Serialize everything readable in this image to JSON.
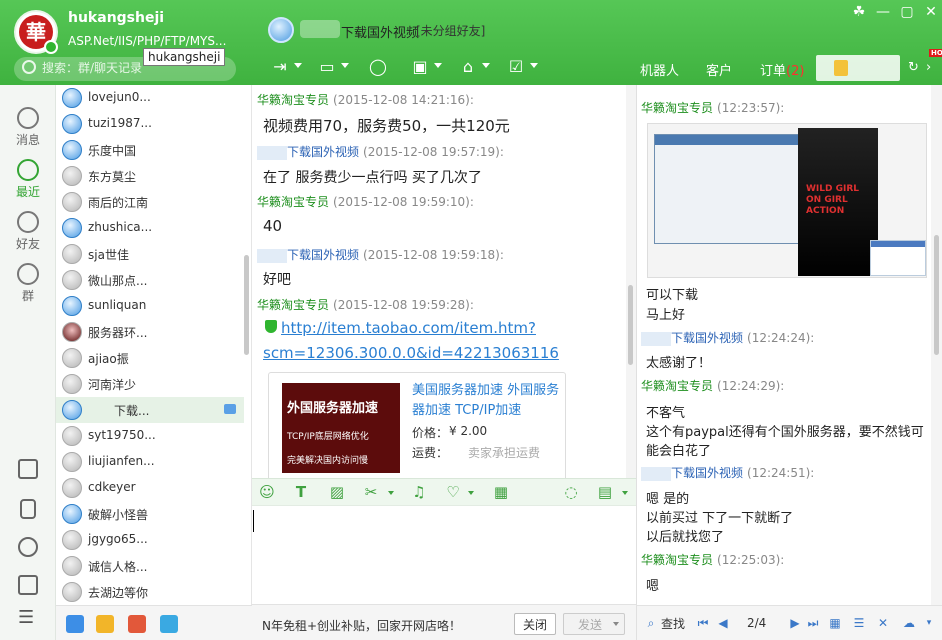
{
  "app": {
    "username": "hukangsheji",
    "signature": "ASP.Net/IIS/PHP/FTP/MYS...",
    "tooltip": "hukangsheji",
    "logo_char": "華",
    "search_placeholder": "搜索：群/聊天记录"
  },
  "contact": {
    "name": "下载国外视频",
    "group": "[未分组好友]"
  },
  "right_tabs": {
    "robot": "机器人",
    "customer": "客户",
    "orders": "订单",
    "orders_badge": "(2)",
    "hot": "HOT"
  },
  "nav": {
    "messages": "消息",
    "recent": "最近",
    "friends": "好友",
    "groups": "群"
  },
  "contacts": [
    {
      "name": "lovejun0...",
      "status": "online"
    },
    {
      "name": "tuzi1987...",
      "status": "online"
    },
    {
      "name": "乐度中国",
      "status": "online"
    },
    {
      "name": "东方莫尘",
      "status": "offline"
    },
    {
      "name": "雨后的江南",
      "status": "offline"
    },
    {
      "name": "zhushica...",
      "status": "online"
    },
    {
      "name": "sja世佳",
      "status": "offline"
    },
    {
      "name": "微山那点...",
      "status": "offline"
    },
    {
      "name": "sunliquan",
      "status": "online"
    },
    {
      "name": "服务器环...",
      "status": "photo"
    },
    {
      "name": "ajiao振",
      "status": "offline"
    },
    {
      "name": "河南洋少",
      "status": "offline"
    },
    {
      "name": "下载...",
      "status": "online"
    },
    {
      "name": "syt19750...",
      "status": "offline"
    },
    {
      "name": "liujianfen...",
      "status": "offline"
    },
    {
      "name": "cdkeyer",
      "status": "offline"
    },
    {
      "name": "破解小怪兽",
      "status": "online"
    },
    {
      "name": "jgygo65...",
      "status": "offline"
    },
    {
      "name": "诚信人格...",
      "status": "offline"
    },
    {
      "name": "去湖边等你",
      "status": "offline"
    }
  ],
  "chat": {
    "messages": [
      {
        "sender": "华籁淘宝专员",
        "time": "(2015-12-08 14:21:16):",
        "text": "视频费用70，服务费50，一共120元"
      },
      {
        "sender": "下载国外视频",
        "time": "(2015-12-08 19:57:19):",
        "text": "在了 服务费少一点行吗 买了几次了"
      },
      {
        "sender": "华籁淘宝专员",
        "time": "(2015-12-08 19:59:10):",
        "text": "40"
      },
      {
        "sender": "下载国外视频",
        "time": "(2015-12-08 19:59:18):",
        "text": "好吧"
      },
      {
        "sender": "华籁淘宝专员",
        "time": "(2015-12-08 19:59:28):",
        "link1": "http://item.taobao.com/item.htm?",
        "link2": "scm=12306.300.0.0&id=42213063116"
      }
    ],
    "product": {
      "img_line1": "外国服务器加速",
      "img_line2": "TCP/IP底层网络优化",
      "img_line3": "完美解决国内访问慢",
      "title": "美国服务器加速 外国服务器加速 TCP/IP加速",
      "price_label": "价格：",
      "price": "¥ 2.00",
      "ship_label": "运费：",
      "ship": "卖家承担运费"
    }
  },
  "composer": {
    "ad_text": "N年免租+创业补贴，回家开网店咯！",
    "close_label": "关闭",
    "send_label": "发送"
  },
  "history": {
    "messages": [
      {
        "sender": "华籁淘宝专员",
        "time": "(12:23:57):"
      },
      {
        "sender": "下载国外视频",
        "time": "(12:24:24):"
      },
      {
        "sender": "华籁淘宝专员",
        "time": "(12:24:29):"
      },
      {
        "sender": "下载国外视频",
        "time": "(12:24:51):"
      },
      {
        "sender": "华籁淘宝专员",
        "time": "(12:25:03):"
      }
    ],
    "lines": {
      "a1": "可以下载",
      "a2": "马上好",
      "b1": "太感谢了！",
      "c1": "不客气",
      "c2": "这个有paypal还得有个国外服务器，要不然钱可",
      "c3": "能会白花了",
      "d1": "嗯 是的",
      "d2": "以前买过 下了一下就断了",
      "d3": "以后就找您了",
      "e1": "嗯"
    },
    "poster_text": "WILD GIRL ON GIRL ACTION",
    "search_label": "查找",
    "page": "2/4"
  },
  "colors": {
    "brand_green": "#3fb23f",
    "self_sender": "#1f8f1f",
    "other_sender": "#2c63b5",
    "link": "#2a7fd2",
    "badge_red": "#ff2f2f"
  }
}
